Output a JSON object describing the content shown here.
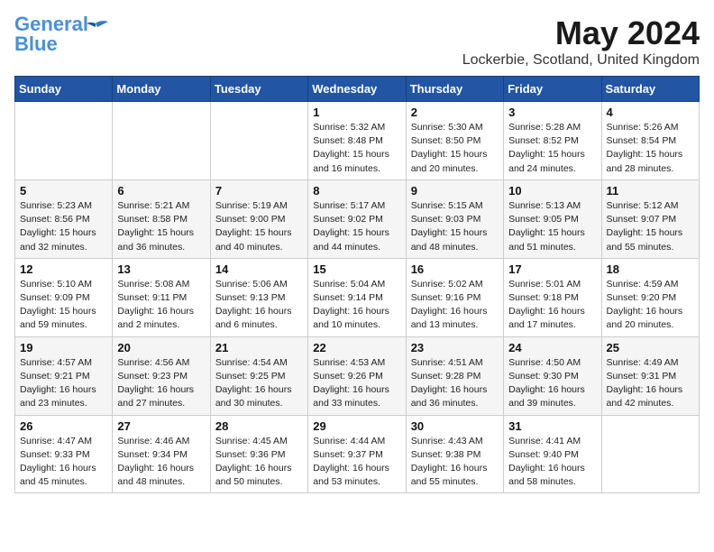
{
  "header": {
    "logo_line1": "General",
    "logo_line2": "Blue",
    "month_title": "May 2024",
    "location": "Lockerbie, Scotland, United Kingdom"
  },
  "days_of_week": [
    "Sunday",
    "Monday",
    "Tuesday",
    "Wednesday",
    "Thursday",
    "Friday",
    "Saturday"
  ],
  "weeks": [
    [
      {
        "day": "",
        "info": ""
      },
      {
        "day": "",
        "info": ""
      },
      {
        "day": "",
        "info": ""
      },
      {
        "day": "1",
        "info": "Sunrise: 5:32 AM\nSunset: 8:48 PM\nDaylight: 15 hours\nand 16 minutes."
      },
      {
        "day": "2",
        "info": "Sunrise: 5:30 AM\nSunset: 8:50 PM\nDaylight: 15 hours\nand 20 minutes."
      },
      {
        "day": "3",
        "info": "Sunrise: 5:28 AM\nSunset: 8:52 PM\nDaylight: 15 hours\nand 24 minutes."
      },
      {
        "day": "4",
        "info": "Sunrise: 5:26 AM\nSunset: 8:54 PM\nDaylight: 15 hours\nand 28 minutes."
      }
    ],
    [
      {
        "day": "5",
        "info": "Sunrise: 5:23 AM\nSunset: 8:56 PM\nDaylight: 15 hours\nand 32 minutes."
      },
      {
        "day": "6",
        "info": "Sunrise: 5:21 AM\nSunset: 8:58 PM\nDaylight: 15 hours\nand 36 minutes."
      },
      {
        "day": "7",
        "info": "Sunrise: 5:19 AM\nSunset: 9:00 PM\nDaylight: 15 hours\nand 40 minutes."
      },
      {
        "day": "8",
        "info": "Sunrise: 5:17 AM\nSunset: 9:02 PM\nDaylight: 15 hours\nand 44 minutes."
      },
      {
        "day": "9",
        "info": "Sunrise: 5:15 AM\nSunset: 9:03 PM\nDaylight: 15 hours\nand 48 minutes."
      },
      {
        "day": "10",
        "info": "Sunrise: 5:13 AM\nSunset: 9:05 PM\nDaylight: 15 hours\nand 51 minutes."
      },
      {
        "day": "11",
        "info": "Sunrise: 5:12 AM\nSunset: 9:07 PM\nDaylight: 15 hours\nand 55 minutes."
      }
    ],
    [
      {
        "day": "12",
        "info": "Sunrise: 5:10 AM\nSunset: 9:09 PM\nDaylight: 15 hours\nand 59 minutes."
      },
      {
        "day": "13",
        "info": "Sunrise: 5:08 AM\nSunset: 9:11 PM\nDaylight: 16 hours\nand 2 minutes."
      },
      {
        "day": "14",
        "info": "Sunrise: 5:06 AM\nSunset: 9:13 PM\nDaylight: 16 hours\nand 6 minutes."
      },
      {
        "day": "15",
        "info": "Sunrise: 5:04 AM\nSunset: 9:14 PM\nDaylight: 16 hours\nand 10 minutes."
      },
      {
        "day": "16",
        "info": "Sunrise: 5:02 AM\nSunset: 9:16 PM\nDaylight: 16 hours\nand 13 minutes."
      },
      {
        "day": "17",
        "info": "Sunrise: 5:01 AM\nSunset: 9:18 PM\nDaylight: 16 hours\nand 17 minutes."
      },
      {
        "day": "18",
        "info": "Sunrise: 4:59 AM\nSunset: 9:20 PM\nDaylight: 16 hours\nand 20 minutes."
      }
    ],
    [
      {
        "day": "19",
        "info": "Sunrise: 4:57 AM\nSunset: 9:21 PM\nDaylight: 16 hours\nand 23 minutes."
      },
      {
        "day": "20",
        "info": "Sunrise: 4:56 AM\nSunset: 9:23 PM\nDaylight: 16 hours\nand 27 minutes."
      },
      {
        "day": "21",
        "info": "Sunrise: 4:54 AM\nSunset: 9:25 PM\nDaylight: 16 hours\nand 30 minutes."
      },
      {
        "day": "22",
        "info": "Sunrise: 4:53 AM\nSunset: 9:26 PM\nDaylight: 16 hours\nand 33 minutes."
      },
      {
        "day": "23",
        "info": "Sunrise: 4:51 AM\nSunset: 9:28 PM\nDaylight: 16 hours\nand 36 minutes."
      },
      {
        "day": "24",
        "info": "Sunrise: 4:50 AM\nSunset: 9:30 PM\nDaylight: 16 hours\nand 39 minutes."
      },
      {
        "day": "25",
        "info": "Sunrise: 4:49 AM\nSunset: 9:31 PM\nDaylight: 16 hours\nand 42 minutes."
      }
    ],
    [
      {
        "day": "26",
        "info": "Sunrise: 4:47 AM\nSunset: 9:33 PM\nDaylight: 16 hours\nand 45 minutes."
      },
      {
        "day": "27",
        "info": "Sunrise: 4:46 AM\nSunset: 9:34 PM\nDaylight: 16 hours\nand 48 minutes."
      },
      {
        "day": "28",
        "info": "Sunrise: 4:45 AM\nSunset: 9:36 PM\nDaylight: 16 hours\nand 50 minutes."
      },
      {
        "day": "29",
        "info": "Sunrise: 4:44 AM\nSunset: 9:37 PM\nDaylight: 16 hours\nand 53 minutes."
      },
      {
        "day": "30",
        "info": "Sunrise: 4:43 AM\nSunset: 9:38 PM\nDaylight: 16 hours\nand 55 minutes."
      },
      {
        "day": "31",
        "info": "Sunrise: 4:41 AM\nSunset: 9:40 PM\nDaylight: 16 hours\nand 58 minutes."
      },
      {
        "day": "",
        "info": ""
      }
    ]
  ]
}
